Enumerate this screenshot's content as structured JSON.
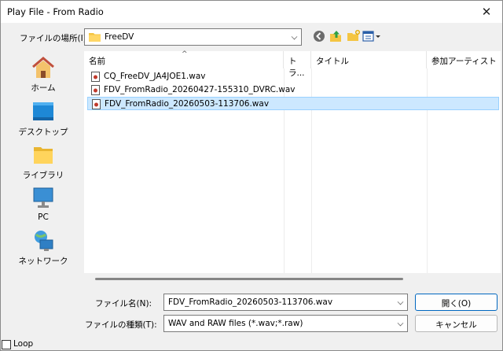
{
  "window": {
    "title": "Play File - From Radio",
    "close_glyph": "✕"
  },
  "location": {
    "label": "ファイルの場所(I):",
    "value": "FreeDV",
    "icons": [
      "folder-icon",
      "back-icon",
      "up-folder-icon",
      "new-folder-icon",
      "view-menu-icon"
    ]
  },
  "places": [
    {
      "label": "ホーム",
      "icon": "home-icon"
    },
    {
      "label": "デスクトップ",
      "icon": "desktop-icon"
    },
    {
      "label": "ライブラリ",
      "icon": "library-icon"
    },
    {
      "label": "PC",
      "icon": "pc-icon"
    },
    {
      "label": "ネットワーク",
      "icon": "network-icon"
    }
  ],
  "filelist": {
    "columns": [
      "名前",
      "トラ...",
      "タイトル",
      "参加アーティスト"
    ],
    "sort_glyph": "^",
    "files": [
      {
        "name": "CQ_FreeDV_JA4JOE1.wav",
        "selected": false
      },
      {
        "name": "FDV_FromRadio_20260427-155310_DVRC.wav",
        "selected": false
      },
      {
        "name": "FDV_FromRadio_20260503-113706.wav",
        "selected": true
      }
    ]
  },
  "filename": {
    "label": "ファイル名(N):",
    "value": "FDV_FromRadio_20260503-113706.wav"
  },
  "filetype": {
    "label": "ファイルの種類(T):",
    "value": "WAV and RAW files (*.wav;*.raw)"
  },
  "buttons": {
    "open": "開く(O)",
    "cancel": "キャンセル"
  },
  "loop": {
    "label": "Loop",
    "checked": false
  },
  "colors": {
    "selection": "#cce8ff",
    "folder": "#f4c542",
    "accent": "#0067c0"
  }
}
